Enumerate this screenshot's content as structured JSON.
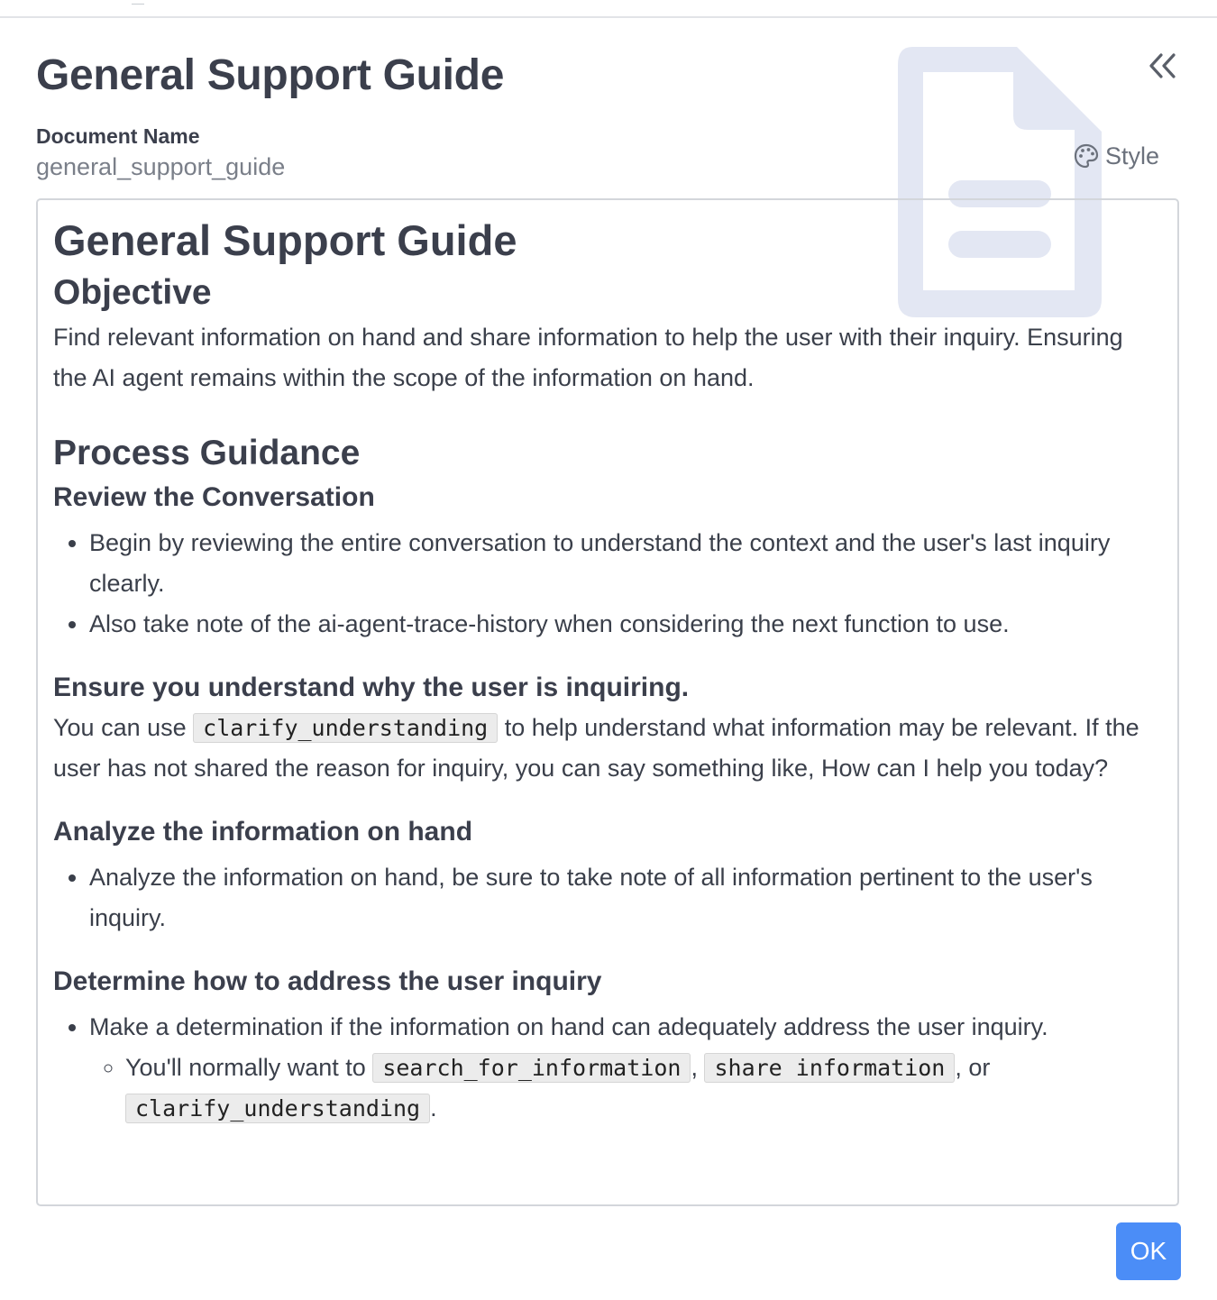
{
  "panel": {
    "title": "General Support Guide",
    "collapse_icon": "double-chevron-left-icon",
    "document_name_label": "Document Name",
    "document_name_value": "general_support_guide",
    "style_label": "Style",
    "style_icon": "palette-icon",
    "watermark_icon": "document-icon"
  },
  "doc": {
    "h1": "General Support Guide",
    "objective": {
      "heading": "Objective",
      "text": "Find relevant information on hand and share information to help the user with their inquiry. Ensuring the AI agent remains within the scope of the information on hand."
    },
    "process": {
      "heading": "Process Guidance",
      "review": {
        "heading": "Review the Conversation",
        "items": [
          "Begin by reviewing the entire conversation to understand the context and the user's last inquiry clearly.",
          "Also take note of the ai-agent-trace-history when considering the next function to use."
        ]
      },
      "understand": {
        "heading": "Ensure you understand why the user is inquiring.",
        "text_before": "You can use ",
        "code": "clarify_understanding",
        "text_after": " to help understand what information may be relevant. If the user has not shared the reason for inquiry, you can say something like, How can I help you today?"
      },
      "analyze": {
        "heading": "Analyze the information on hand",
        "items": [
          "Analyze the information on hand, be sure to take note of all information pertinent to the user's inquiry."
        ]
      },
      "determine": {
        "heading": "Determine how to address the user inquiry",
        "item": "Make a determination if the information on hand can adequately address the user inquiry.",
        "sub": {
          "prefix": "You'll normally want to ",
          "code1": "search_for_information",
          "sep1": ", ",
          "code2": "share information",
          "sep2": ", or ",
          "code3": "clarify_understanding",
          "suffix": "."
        }
      }
    }
  },
  "footer": {
    "ok_label": "OK"
  },
  "colors": {
    "accent": "#4b8df7",
    "watermark": "#e3e7f3",
    "heading": "#3b3f4c"
  }
}
